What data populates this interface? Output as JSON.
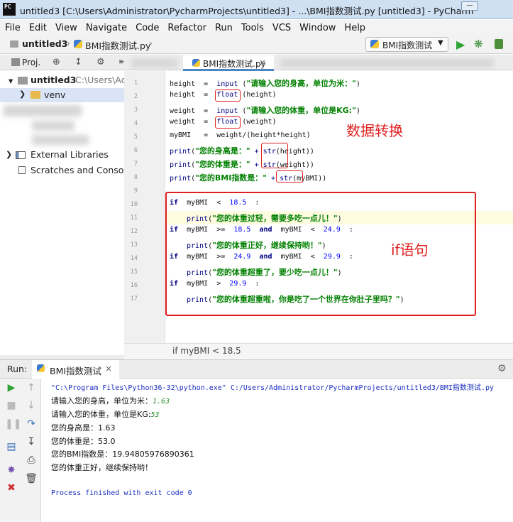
{
  "window": {
    "title": "untitled3 [C:\\Users\\Administrator\\PycharmProjects\\untitled3] - ...\\BMI指数测试.py [untitled3] - PyCharm",
    "logo": "PC"
  },
  "menu": [
    "File",
    "Edit",
    "View",
    "Navigate",
    "Code",
    "Refactor",
    "Run",
    "Tools",
    "VCS",
    "Window",
    "Help"
  ],
  "nav": {
    "project": "untitled3",
    "separator": "›",
    "file": "BMI指数测试.py",
    "run_config": "BMI指数测试"
  },
  "project_panel": {
    "tab_label": "Proj.",
    "tools": "⊕ ↕ ⚙ ⇤",
    "root_label": "untitled3",
    "root_path": "C:\\Users\\Ad",
    "venv_label": "venv",
    "external_libraries": "External Libraries",
    "scratches": "Scratches and Consoles"
  },
  "editor": {
    "tab_label": "BMI指数测试.py",
    "tab_close": "×",
    "breadcrumb": "if myBMI < 18.5",
    "line_numbers": [
      "1",
      "2",
      "3",
      "4",
      "5",
      "6",
      "7",
      "8",
      "9",
      "10",
      "11",
      "12",
      "13",
      "14",
      "15",
      "16",
      "17"
    ],
    "annotations": {
      "conversion": "数据转换",
      "if_statement": "if语句"
    }
  },
  "code": {
    "l1_a": "height  =  ",
    "l1_fn": "input",
    "l1_b": " (",
    "l1_str": "\"请输入您的身高，单位为米：\"",
    "l1_c": ")",
    "l2_a": "height  =  ",
    "l2_fn": "float",
    "l2_b": " (height)",
    "l3_a": "weight  =  ",
    "l3_fn": "input",
    "l3_b": " (",
    "l3_str": "\"请输入您的体重，单位是KG:\"",
    "l3_c": ")",
    "l4_a": "weight  =  ",
    "l4_fn": "float",
    "l4_b": " (weight)",
    "l5": "myBMI   =  weight/(height*height)",
    "l6_fn": "print",
    "l6_b": "(",
    "l6_str": "\"您的身高是：\"",
    "l6_c": " + str",
    "l6_d": "(height))",
    "l7_fn": "print",
    "l7_b": "(",
    "l7_str": "\"您的体重是：\"",
    "l7_c": " + str",
    "l7_d": "(weight))",
    "l8_fn": "print",
    "l8_b": "(",
    "l8_str": "\"您的BMI指数是：\"",
    "l8_c": " + str",
    "l8_d": "(myBMI))",
    "l10_kw": "if",
    "l10_a": "  myBMI  <  ",
    "l10_num": "18.5",
    "l10_b": "  :",
    "l11_fn": "print",
    "l11_b": "(",
    "l11_str": "\"您的体重过轻，需要多吃一点儿！\"",
    "l11_c": ")",
    "l12_kw": "if",
    "l12_a": "  myBMI  >=  ",
    "l12_num": "18.5",
    "l12_kw2": "  and",
    "l12_b": "  myBMI  <  ",
    "l12_num2": "24.9",
    "l12_c": "  :",
    "l13_fn": "print",
    "l13_b": "(",
    "l13_str": "\"您的体重正好，继续保持哟！\"",
    "l13_c": ")",
    "l14_kw": "if",
    "l14_a": "  myBMI  >=  ",
    "l14_num": "24.9",
    "l14_kw2": "  and",
    "l14_b": "  myBMI  <  ",
    "l14_num2": "29.9",
    "l14_c": "  :",
    "l15_fn": "print",
    "l15_b": "(",
    "l15_str": "\"您的体重超重了，要少吃一点儿！\"",
    "l15_c": ")",
    "l16_kw": "if",
    "l16_a": "  myBMI  >  ",
    "l16_num": "29.9",
    "l16_b": "  :",
    "l17_fn": "print",
    "l17_b": "(",
    "l17_str": "\"您的体重超重啦，你是吃了一个世界在你肚子里吗？\"",
    "l17_c": ")"
  },
  "run_panel": {
    "label": "Run:",
    "tab_label": "BMI指数测试",
    "tab_close": "×",
    "gear": "⚙"
  },
  "console": {
    "command": "\"C:\\Program Files\\Python36-32\\python.exe\" C:/Users/Administrator/PycharmProjects/untitled3/BMI指数测试.py",
    "prompt1": "请输入您的身高，单位为米：",
    "input1": "1.63",
    "prompt2": "请输入您的体重，单位是KG:",
    "input2": "53",
    "out1": "您的身高是：1.63",
    "out2": "您的体重是：53.0",
    "out3": "您的BMI指数是：19.94805976890361",
    "out4": "您的体重正好，继续保持哟！",
    "exit": "Process finished with exit code 0"
  },
  "colors": {
    "run_green": "#2ea234",
    "annotation_red": "#e02020",
    "keyword_blue": "#000080",
    "string_green": "#008000"
  }
}
